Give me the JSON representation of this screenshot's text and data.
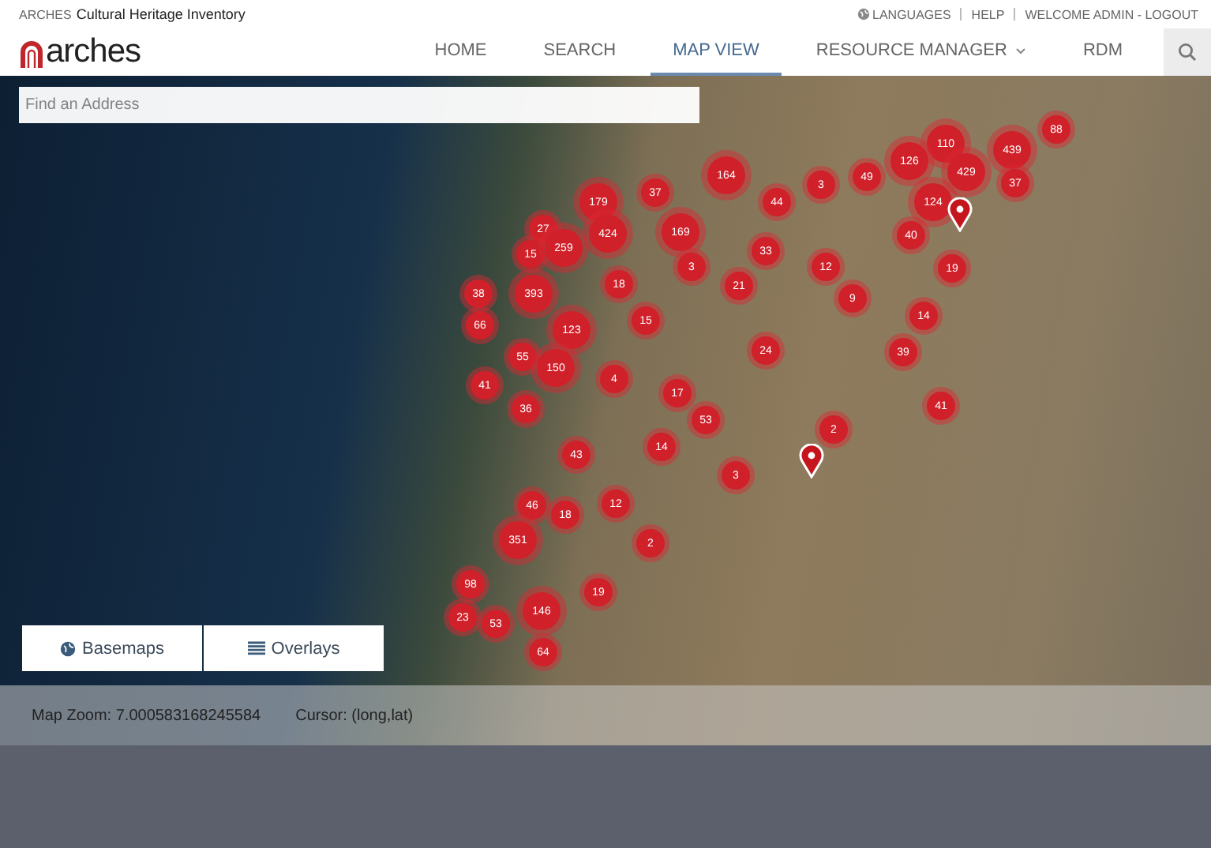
{
  "header": {
    "brand": "ARCHES",
    "site_title": "Cultural Heritage Inventory",
    "links": [
      "LANGUAGES",
      "HELP",
      "WELCOME ADMIN - LOGOUT"
    ]
  },
  "logo": {
    "text": "arches"
  },
  "nav": [
    {
      "label": "HOME",
      "selected": false,
      "has_menu": false
    },
    {
      "label": "SEARCH",
      "selected": false,
      "has_menu": false
    },
    {
      "label": "MAP VIEW",
      "selected": true,
      "has_menu": false
    },
    {
      "label": "RESOURCE MANAGER",
      "selected": false,
      "has_menu": true
    },
    {
      "label": "RDM",
      "selected": false,
      "has_menu": false
    }
  ],
  "search": {
    "placeholder": "Find an Address"
  },
  "clusters": [
    "164",
    "3",
    "44",
    "49",
    "110",
    "126",
    "429",
    "439",
    "88",
    "37",
    "124",
    "40",
    "19",
    "179",
    "37",
    "27",
    "424",
    "169",
    "15",
    "259",
    "3",
    "33",
    "12",
    "21",
    "18",
    "38",
    "393",
    "9",
    "14",
    "66",
    "123",
    "15",
    "24",
    "39",
    "55",
    "150",
    "41",
    "4",
    "17",
    "36",
    "41",
    "53",
    "2",
    "14",
    "43",
    "3",
    "46",
    "18",
    "12",
    "351",
    "2",
    "98",
    "19",
    "146",
    "23",
    "53",
    "64"
  ],
  "map_buttons": [
    {
      "label": "Basemaps",
      "kind": "basemaps"
    },
    {
      "label": "Overlays",
      "kind": "overlays"
    }
  ],
  "status": {
    "zoom": "Map Zoom: 7.000583168245584",
    "cursor": "Cursor: (long,lat)"
  }
}
